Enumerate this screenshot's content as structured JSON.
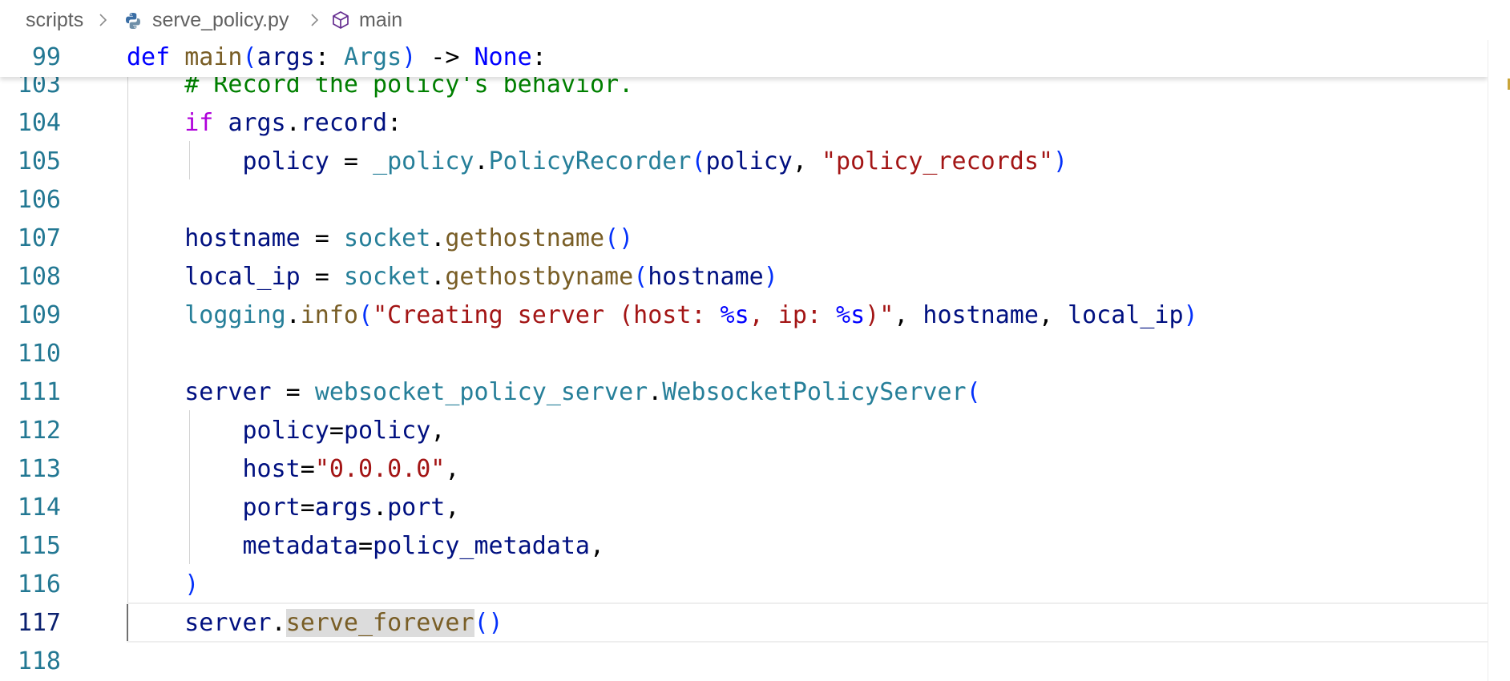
{
  "breadcrumb": {
    "folder": "scripts",
    "file": "serve_policy.py",
    "symbol": "main",
    "sep": ">"
  },
  "sticky_line": {
    "number": "99",
    "kw_def": "def",
    "fn_name": "main",
    "p1": "(",
    "arg": "args",
    "colon": ": ",
    "type": "Args",
    "p2": ")",
    "arrow": " -> ",
    "ret": "None",
    "end": ":"
  },
  "lines": {
    "l103": {
      "n": "103",
      "comment": "# Record the policy's behavior."
    },
    "l104": {
      "n": "104",
      "kw": "if",
      "rest_var": "args",
      "dot": ".",
      "attr": "record",
      "colon": ":"
    },
    "l105": {
      "n": "105",
      "var": "policy",
      "eq": " = ",
      "mod": "_policy",
      "dot": ".",
      "cls": "PolicyRecorder",
      "p1": "(",
      "arg": "policy",
      "comma": ", ",
      "str": "\"policy_records\"",
      "p2": ")"
    },
    "l106": {
      "n": "106"
    },
    "l107": {
      "n": "107",
      "var": "hostname",
      "eq": " = ",
      "mod": "socket",
      "dot": ".",
      "fn": "gethostname",
      "parens": "()"
    },
    "l108": {
      "n": "108",
      "var": "local_ip",
      "eq": " = ",
      "mod": "socket",
      "dot": ".",
      "fn": "gethostbyname",
      "p1": "(",
      "arg": "hostname",
      "p2": ")"
    },
    "l109": {
      "n": "109",
      "mod": "logging",
      "dot": ".",
      "fn": "info",
      "p1": "(",
      "s1": "\"Creating server (host: ",
      "f1": "%s",
      "s2": ", ip: ",
      "f2": "%s",
      "s3": ")\"",
      "c1": ", ",
      "a1": "hostname",
      "c2": ", ",
      "a2": "local_ip",
      "p2": ")"
    },
    "l110": {
      "n": "110"
    },
    "l111": {
      "n": "111",
      "var": "server",
      "eq": " = ",
      "mod": "websocket_policy_server",
      "dot": ".",
      "cls": "WebsocketPolicyServer",
      "p1": "("
    },
    "l112": {
      "n": "112",
      "k": "policy",
      "eq": "=",
      "v": "policy",
      "comma": ","
    },
    "l113": {
      "n": "113",
      "k": "host",
      "eq": "=",
      "v": "\"0.0.0.0\"",
      "comma": ","
    },
    "l114": {
      "n": "114",
      "k": "port",
      "eq": "=",
      "v1": "args",
      "dot": ".",
      "v2": "port",
      "comma": ","
    },
    "l115": {
      "n": "115",
      "k": "metadata",
      "eq": "=",
      "v": "policy_metadata",
      "comma": ","
    },
    "l116": {
      "n": "116",
      "p": ")"
    },
    "l117": {
      "n": "117",
      "var": "server",
      "dot": ".",
      "fn": "serve_forever",
      "parens": "()"
    },
    "l118": {
      "n": "118"
    }
  },
  "colors": {
    "keyword": "#0000ff",
    "control_keyword": "#af00db",
    "function": "#795e26",
    "type": "#267f99",
    "string": "#a31515",
    "comment": "#008000",
    "variable": "#001080",
    "line_number": "#237893",
    "scroll_marker": "#c9a53a"
  }
}
